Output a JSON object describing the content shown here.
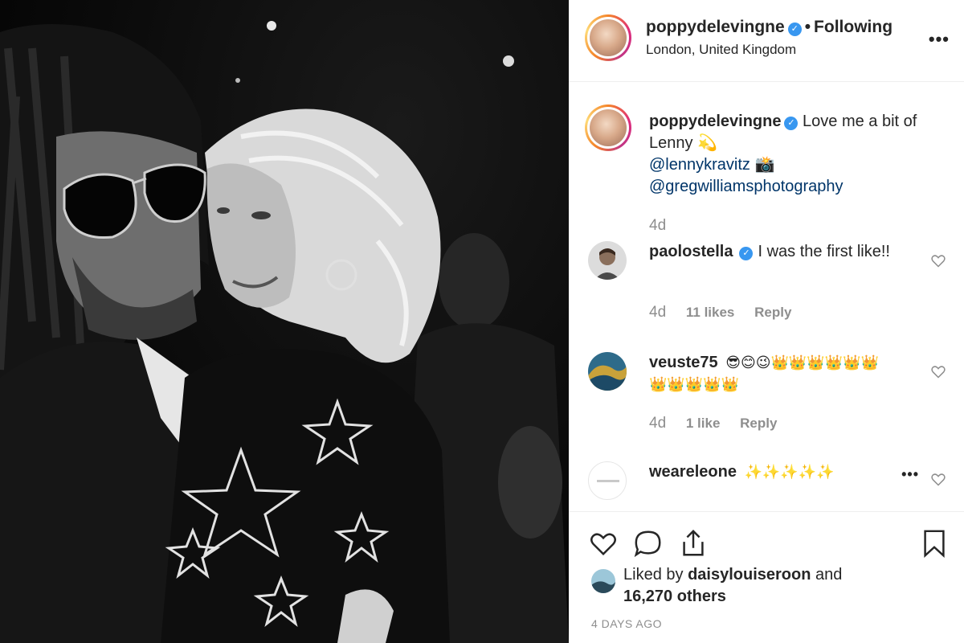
{
  "post": {
    "username": "poppydelevingne",
    "follow_state": "Following",
    "location": "London, United Kingdom",
    "more_label": "•••",
    "dot": "•"
  },
  "caption": {
    "username": "poppydelevingne",
    "text": "Love me a bit of Lenny 💫",
    "mention_1": "@lennykravitz 📸",
    "mention_2": "@gregwilliamsphotography",
    "time": "4d"
  },
  "comments": [
    {
      "username": "paolostella",
      "verified": true,
      "text": "I was the first like!!",
      "time": "4d",
      "likes": "11 likes",
      "reply": "Reply"
    },
    {
      "username": "veuste75",
      "verified": false,
      "text": "😎😊😉👑👑👑👑👑👑👑👑👑👑👑",
      "time": "4d",
      "likes": "1 like",
      "reply": "Reply"
    },
    {
      "username": "weareleone",
      "verified": false,
      "text": "✨✨✨✨✨",
      "more": "•••"
    }
  ],
  "likes": {
    "prefix": "Liked by",
    "user": "daisylouiseroon",
    "middle": "and",
    "others": "16,270 others"
  },
  "timestamp": "4 DAYS AGO",
  "icons": {
    "like": "heart-icon",
    "comment": "comment-icon",
    "share": "share-icon",
    "save": "bookmark-icon",
    "verified": "verified-badge-icon"
  },
  "colors": {
    "link": "#003569",
    "verified": "#3897f0",
    "muted": "#8e8e8e",
    "text": "#262626"
  }
}
